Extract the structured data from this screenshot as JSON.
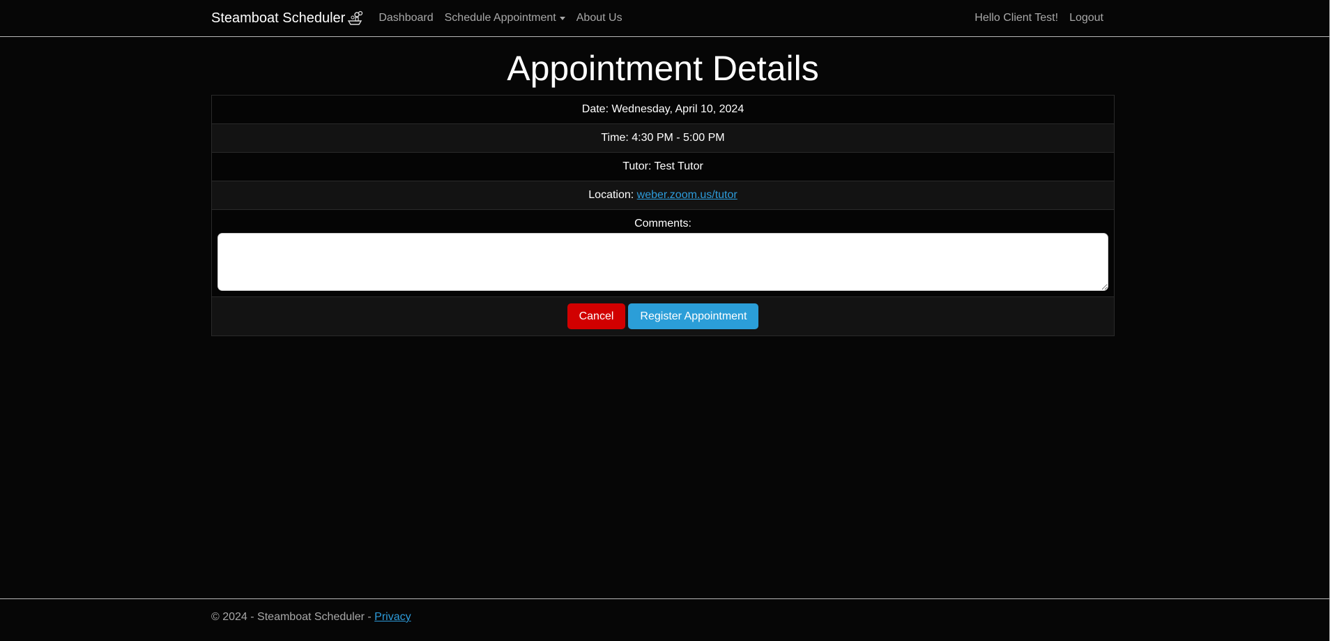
{
  "navbar": {
    "brand": "Steamboat Scheduler",
    "brand_icon": "steamboat-icon",
    "links": {
      "dashboard": "Dashboard",
      "schedule": "Schedule Appointment",
      "about": "About Us"
    },
    "greeting": "Hello Client Test!",
    "logout": "Logout"
  },
  "page": {
    "title": "Appointment Details"
  },
  "details": {
    "date_label": "Date:",
    "date": "Wednesday, April 10, 2024",
    "time_label": "Time:",
    "time": "4:30 PM - 5:00 PM",
    "tutor_label": "Tutor:",
    "tutor": "Test Tutor",
    "location_label": "Location:",
    "location": "weber.zoom.us/tutor",
    "comments_label": "Comments:",
    "comments_value": ""
  },
  "actions": {
    "cancel": "Cancel",
    "register": "Register Appointment"
  },
  "footer": {
    "text": "© 2024 - Steamboat Scheduler - ",
    "privacy": "Privacy"
  },
  "colors": {
    "background": "#060606",
    "link": "#2d9cdb",
    "cancel": "#d10000",
    "register": "#2b9ed8"
  }
}
